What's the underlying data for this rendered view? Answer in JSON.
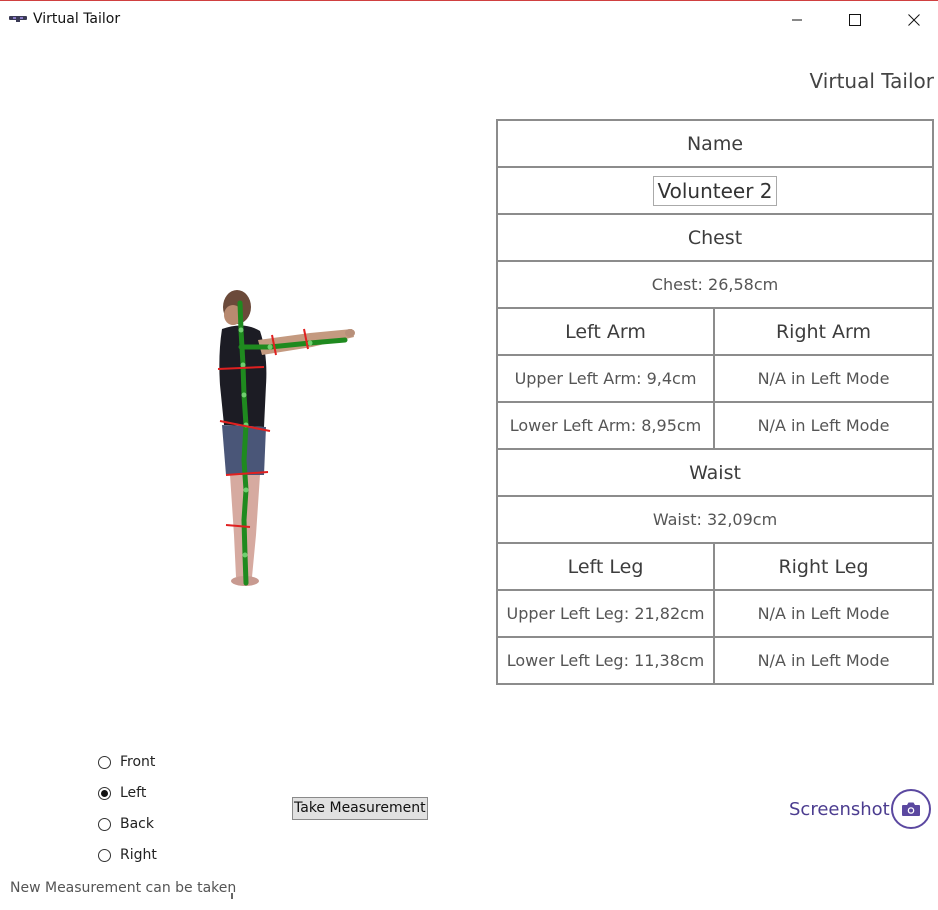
{
  "window": {
    "title": "Virtual Tailor"
  },
  "header": {
    "brand": "Virtual Tailor"
  },
  "table": {
    "name_header": "Name",
    "name_value": "Volunteer 2",
    "chest_header": "Chest",
    "chest_value": "Chest: 26,58cm",
    "left_arm_header": "Left Arm",
    "right_arm_header": "Right Arm",
    "upper_left_arm": "Upper Left Arm: 9,4cm",
    "upper_right_arm": "N/A in Left Mode",
    "lower_left_arm": "Lower Left Arm: 8,95cm",
    "lower_right_arm": "N/A in Left Mode",
    "waist_header": "Waist",
    "waist_value": "Waist: 32,09cm",
    "left_leg_header": "Left Leg",
    "right_leg_header": "Right Leg",
    "upper_left_leg": "Upper Left Leg: 21,82cm",
    "upper_right_leg": "N/A in Left Mode",
    "lower_left_leg": "Lower Left Leg: 11,38cm",
    "lower_right_leg": "N/A in Left Mode"
  },
  "view_mode": {
    "options": [
      "Front",
      "Left",
      "Back",
      "Right"
    ],
    "selected": "Left"
  },
  "actions": {
    "take_measurement": "Take Measurement",
    "screenshot": "Screenshot"
  },
  "status": {
    "message": "New Measurement can be taken"
  },
  "icons": {
    "camera": "camera-icon",
    "minimize": "minimize-icon",
    "maximize": "maximize-icon",
    "close": "close-icon"
  },
  "colors": {
    "accent": "#5b48a0",
    "skeleton": "#1f8a1f",
    "measure_lines": "#e02020",
    "table_border": "#8c8c8c"
  }
}
